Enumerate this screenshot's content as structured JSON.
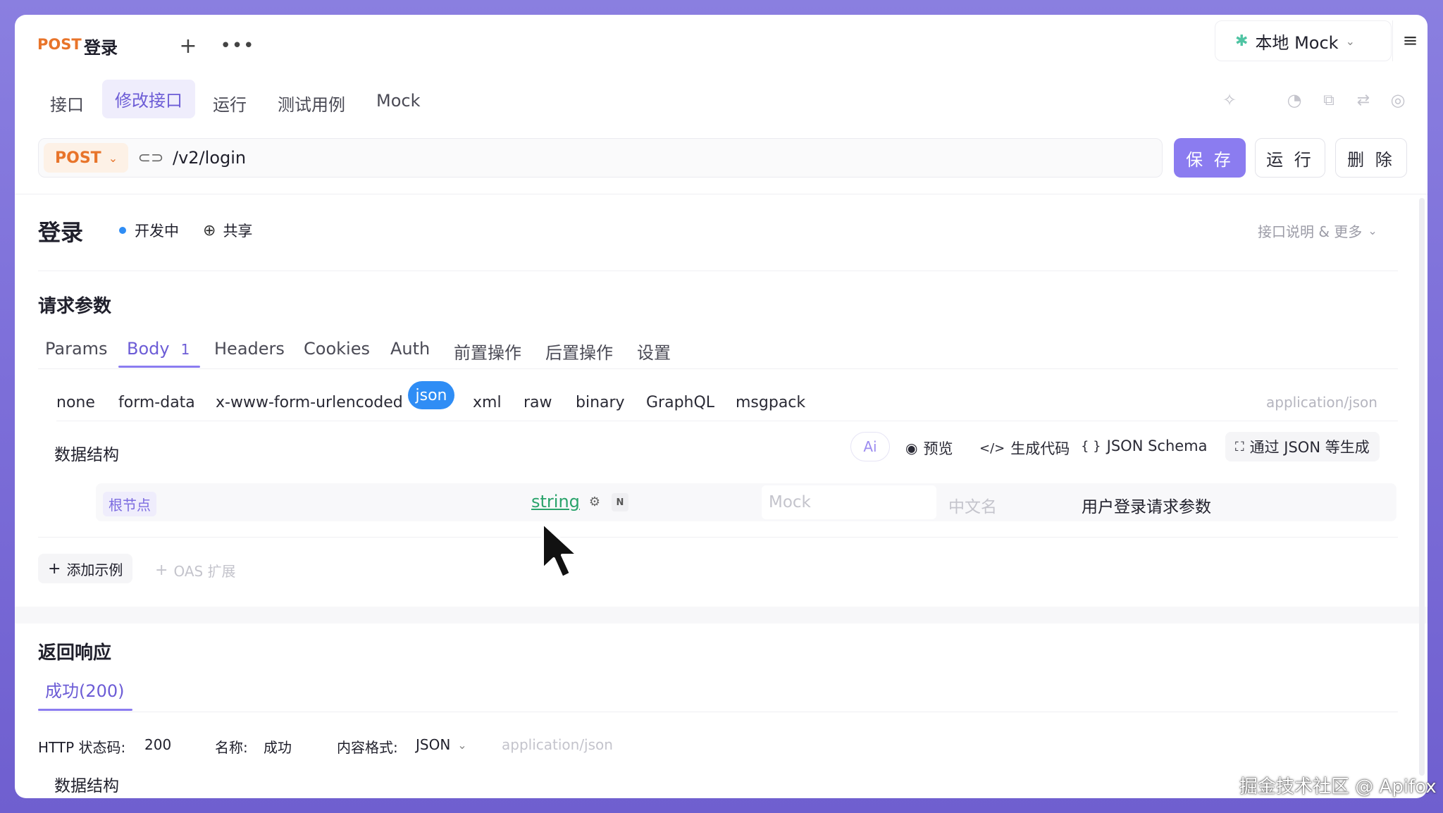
{
  "header": {
    "method": "POST",
    "title": "登录",
    "env_label": "本地 Mock"
  },
  "tabs": [
    {
      "label": "接口"
    },
    {
      "label": "修改接口"
    },
    {
      "label": "运行"
    },
    {
      "label": "测试用例"
    },
    {
      "label": "Mock"
    }
  ],
  "url_bar": {
    "method": "POST",
    "path": "/v2/login",
    "save_label": "保 存",
    "run_label": "运 行",
    "delete_label": "删 除"
  },
  "api": {
    "name": "登录",
    "status": "开发中",
    "share": "共享",
    "more_label": "接口说明 & 更多"
  },
  "request": {
    "section_title": "请求参数",
    "tabs": [
      {
        "label": "Params"
      },
      {
        "label": "Body",
        "badge": "1"
      },
      {
        "label": "Headers"
      },
      {
        "label": "Cookies"
      },
      {
        "label": "Auth"
      },
      {
        "label": "前置操作"
      },
      {
        "label": "后置操作"
      },
      {
        "label": "设置"
      }
    ],
    "body_types": [
      "none",
      "form-data",
      "x-www-form-urlencoded",
      "json",
      "xml",
      "raw",
      "binary",
      "GraphQL",
      "msgpack"
    ],
    "content_type": "application/json",
    "data_structure_label": "数据结构",
    "tools": {
      "ai": "Ai",
      "preview": "预览",
      "gen_code": "生成代码",
      "json_schema": "JSON Schema",
      "from_json": "通过 JSON 等生成"
    },
    "root_row": {
      "name": "根节点",
      "type": "string",
      "n_badge": "N",
      "mock_placeholder": "Mock",
      "cn_name_placeholder": "中文名",
      "description": "用户登录请求参数"
    },
    "add_example": "添加示例",
    "oas_ext": "OAS 扩展"
  },
  "response": {
    "section_title": "返回响应",
    "tab": "成功(200)",
    "http_status_label": "HTTP 状态码:",
    "http_status_value": "200",
    "name_label": "名称:",
    "name_value": "成功",
    "format_label": "内容格式:",
    "format_value": "JSON",
    "format_mime": "application/json",
    "data_structure_label": "数据结构"
  },
  "watermark": "掘金技术社区 @ Apifox",
  "colors": {
    "accent": "#8b7cf0",
    "method": "#e8742a",
    "json_pill": "#2f8df5",
    "status_dot": "#2f8df5",
    "type_green": "#2aa36b"
  }
}
